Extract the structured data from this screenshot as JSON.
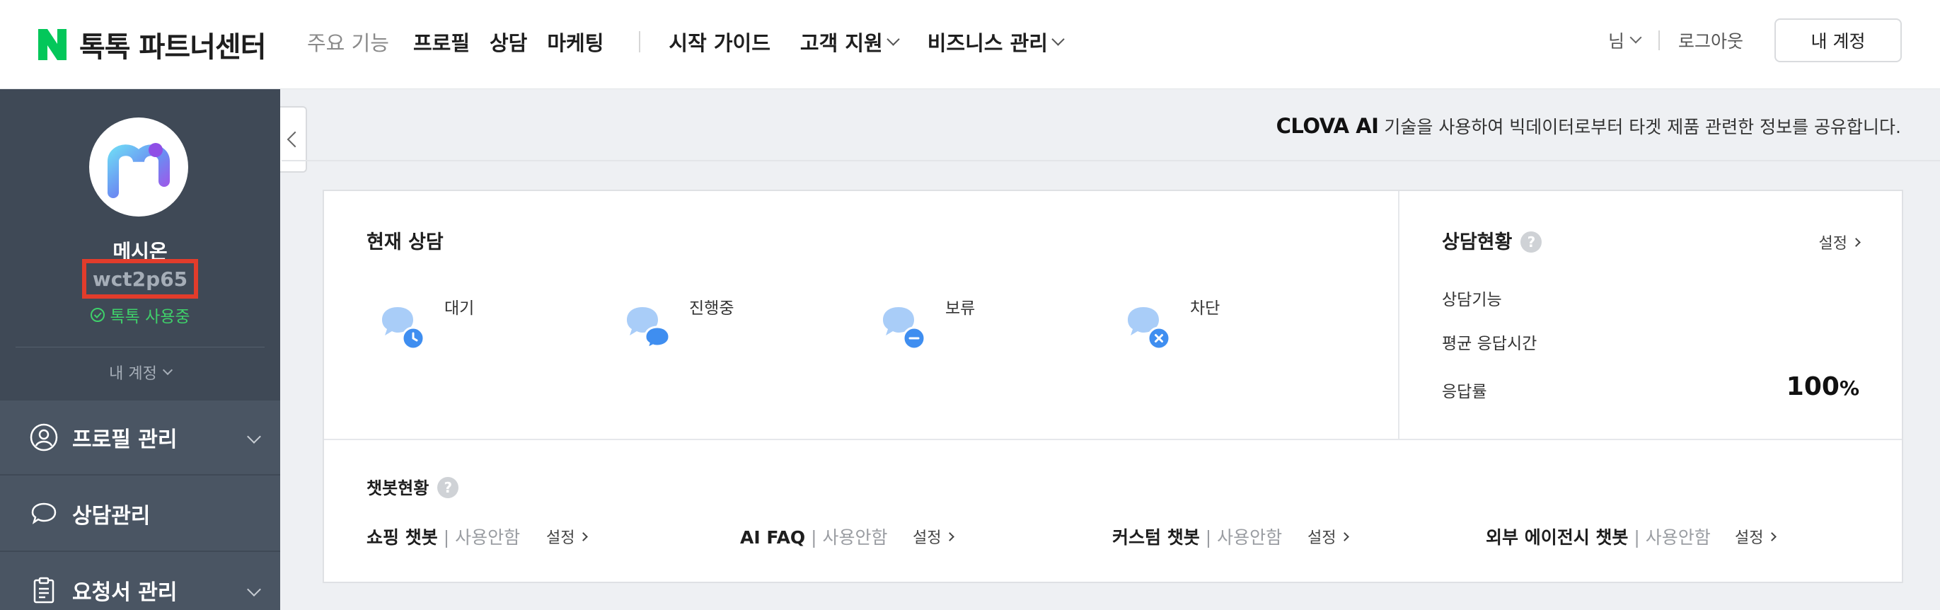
{
  "header": {
    "brand": "톡톡 파트너센터",
    "nav_muted": "주요 기능",
    "nav_main": [
      "프로필",
      "상담",
      "마케팅"
    ],
    "nav_guide": "시작 가이드",
    "nav_support": "고객 지원",
    "nav_business": "비즈니스 관리",
    "user_suffix": "님",
    "logout": "로그아웃",
    "my_account_button": "내 계정"
  },
  "sidebar": {
    "profile_name": "메시온",
    "profile_id": "wct2p65",
    "status": "톡톡 사용중",
    "my_account": "내 계정",
    "menu": [
      {
        "label": "프로필 관리",
        "icon": "person-icon"
      },
      {
        "label": "상담관리",
        "icon": "chat-icon"
      },
      {
        "label": "요청서 관리",
        "icon": "clipboard-icon"
      }
    ]
  },
  "main": {
    "clova_brand": "CLOVA AI",
    "clova_text": " 기술을 사용하여 빅데이터로부터 타겟 제품 관련한 정보를 공유합니다.",
    "current_title": "현재 상담",
    "statuses": [
      {
        "label": "대기",
        "badge": "clock-icon"
      },
      {
        "label": "진행중",
        "badge": "chat-icon"
      },
      {
        "label": "보류",
        "badge": "minus-icon"
      },
      {
        "label": "차단",
        "badge": "x-icon"
      }
    ],
    "status_panel_title": "상담현황",
    "status_panel_setting": "설정",
    "status_rows": [
      "상담기능",
      "평균 응답시간",
      "응답률"
    ],
    "response_rate": "100",
    "response_rate_unit": "%",
    "chatbot_title": "챗봇현황",
    "chatbots": [
      {
        "name": "쇼핑 챗봇",
        "state": "| 사용안함",
        "setting": "설정"
      },
      {
        "name": "AI FAQ",
        "state": "| 사용안함",
        "setting": "설정"
      },
      {
        "name": "커스텀 챗봇",
        "state": "| 사용안함",
        "setting": "설정"
      },
      {
        "name": "외부 에이전시 챗봇",
        "state": "| 사용안함",
        "setting": "설정"
      }
    ],
    "help_mark": "?"
  },
  "colors": {
    "brand_green": "#03c75a",
    "sidebar_bg": "#4a5563",
    "highlight_red": "#e23c2b",
    "bubble_blue": "#3f8ef0"
  }
}
